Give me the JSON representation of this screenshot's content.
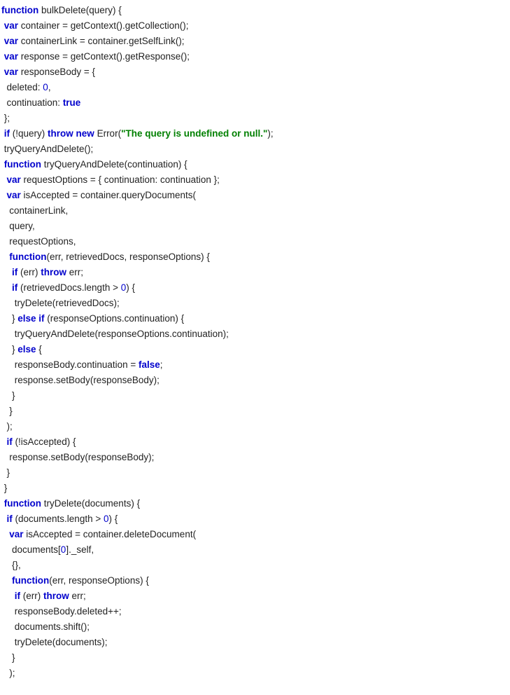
{
  "code": {
    "kw_function": "function",
    "kw_var": "var",
    "kw_if": "if",
    "kw_throw": "throw",
    "kw_new": "new",
    "kw_else": "else",
    "kw_elseif": "else if",
    "kw_true": "true",
    "kw_false": "false",
    "num_0": "0",
    "str_error": "\"The query is undefined or null.\"",
    "line1_a": " bulkDelete(query) {",
    "line2_a": " container = getContext().getCollection();",
    "line3_a": " containerLink = container.getSelfLink();",
    "line4_a": " response = getContext().getResponse();",
    "line5_a": " responseBody = {",
    "line6_a": "  deleted: ",
    "line6_b": ",",
    "line7_a": "  continuation: ",
    "line8_a": " };",
    "line9_a": " (!query) ",
    "line9_b": " Error(",
    "line9_c": ");",
    "line10_a": " tryQueryAndDelete();",
    "line11_a": " tryQueryAndDelete(continuation) {",
    "line12_a": " requestOptions = { continuation: continuation };",
    "line13_a": " isAccepted = container.queryDocuments(",
    "line14_a": "   containerLink,",
    "line15_a": "   query,",
    "line16_a": "   requestOptions,",
    "line17_a": "(err, retrievedDocs, responseOptions) {",
    "line18_a": " (err) ",
    "line18_b": " err;",
    "line19_a": " (retrievedDocs.length > ",
    "line19_b": ") {",
    "line20_a": "     tryDelete(retrievedDocs);",
    "line21_a": "    } ",
    "line21_b": " (responseOptions.continuation) {",
    "line22_a": "     tryQueryAndDelete(responseOptions.continuation);",
    "line23_a": "    } ",
    "line23_b": " {",
    "line24_a": "     responseBody.continuation = ",
    "line24_b": ";",
    "line25_a": "     response.setBody(responseBody);",
    "line26_a": "    }",
    "line27_a": "   }",
    "line28_a": "  );",
    "line29_a": " (!isAccepted) {",
    "line30_a": "   response.setBody(responseBody);",
    "line31_a": "  }",
    "line32_a": " }",
    "line33_a": " tryDelete(documents) {",
    "line34_a": " (documents.length > ",
    "line34_b": ") {",
    "line35_a": " isAccepted = container.deleteDocument(",
    "line36_a": "    documents[",
    "line36_b": "]._self,",
    "line37_a": "    {},",
    "line38_a": "(err, responseOptions) {",
    "line39_a": " (err) ",
    "line39_b": " err;",
    "line40_a": "     responseBody.deleted++;",
    "line41_a": "     documents.shift();",
    "line42_a": "     tryDelete(documents);",
    "line43_a": "    }",
    "line44_a": "   );"
  }
}
